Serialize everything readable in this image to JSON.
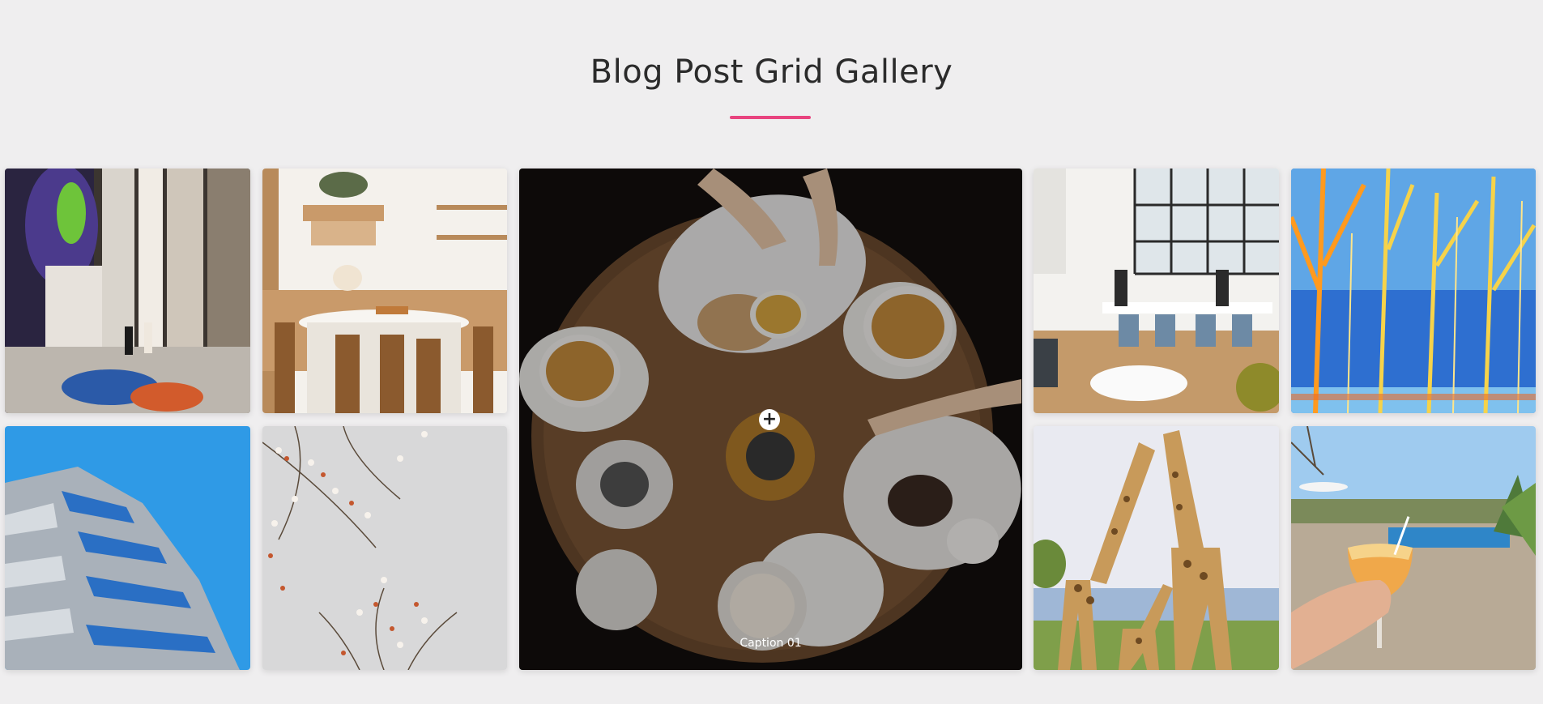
{
  "page": {
    "title": "Blog Post Grid Gallery",
    "accent_color": "#e8447f",
    "background_color": "#efeeef"
  },
  "gallery": {
    "items": [
      {
        "name": "architecture-people",
        "subject": "building facade with people"
      },
      {
        "name": "kitchen-dining",
        "subject": "kitchen with dining table"
      },
      {
        "name": "coffee-table",
        "subject": "coffee and pastries on round table",
        "caption": "Caption 01",
        "hover_icon": "plus-icon",
        "active": true
      },
      {
        "name": "office-meeting",
        "subject": "bright office with meeting table"
      },
      {
        "name": "blue-forest",
        "subject": "blue and orange trees"
      },
      {
        "name": "blue-building",
        "subject": "geometric blue building"
      },
      {
        "name": "white-flowers",
        "subject": "dried flower branches"
      },
      {
        "name": "giraffes",
        "subject": "giraffes family"
      },
      {
        "name": "cocktail-pool",
        "subject": "cocktail by pool"
      }
    ]
  }
}
